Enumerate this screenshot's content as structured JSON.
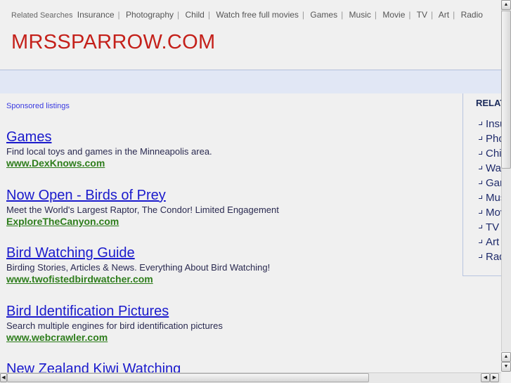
{
  "topnav": {
    "label": "Related Searches",
    "links": [
      "Insurance",
      "Photography",
      "Child",
      "Watch free full movies",
      "Games",
      "Music",
      "Movie",
      "TV",
      "Art",
      "Radio"
    ]
  },
  "logo": "MRSSPARROW.COM",
  "sponsored": "Sponsored listings",
  "listings": [
    {
      "title": "Games",
      "desc": "Find local toys and games in the Minneapolis area.",
      "url": "www.DexKnows.com"
    },
    {
      "title": "Now Open - Birds of Prey",
      "desc": "Meet the World's Largest Raptor, The Condor! Limited Engagement",
      "url": "ExploreTheCanyon.com"
    },
    {
      "title": "Bird Watching Guide",
      "desc": "Birding Stories, Articles & News. Everything About Bird Watching!",
      "url": "www.twofistedbirdwatcher.com"
    },
    {
      "title": "Bird Identification Pictures",
      "desc": "Search multiple engines for bird identification pictures",
      "url": "www.webcrawler.com"
    },
    {
      "title": "New Zealand Kiwi Watching",
      "desc": "",
      "url": ""
    }
  ],
  "sidebar": {
    "heading": "RELATED SEARCHES",
    "items": [
      "Insurance",
      "Photography",
      "Child",
      "Watch free full movies",
      "Games",
      "Music",
      "Movie",
      "TV",
      "Art",
      "Radio"
    ]
  },
  "scroll": {
    "up": "▲",
    "down": "▼",
    "left": "◀",
    "right": "▶"
  }
}
